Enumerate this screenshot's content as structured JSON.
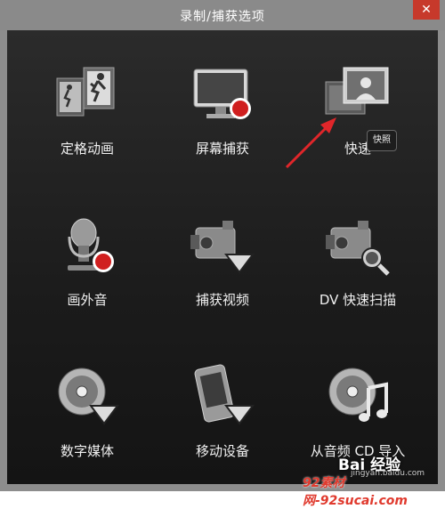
{
  "window": {
    "title": "录制/捕获选项",
    "close_symbol": "✕"
  },
  "tiles": [
    {
      "label": "定格动画"
    },
    {
      "label": "屏幕捕获"
    },
    {
      "label": "快速"
    },
    {
      "label": "画外音"
    },
    {
      "label": "捕获视频"
    },
    {
      "label": "DV 快速扫描"
    },
    {
      "label": "数字媒体"
    },
    {
      "label": "移动设备"
    },
    {
      "label": "从音频 CD 导入"
    }
  ],
  "tooltip": {
    "text": "快照"
  },
  "watermarks": {
    "baidu": "Bai 经验",
    "baidu_sub": "jingyan.baidu.com",
    "site": "92素材网-92sucai.com"
  },
  "colors": {
    "arrow": "#e0262a",
    "record_dot": "#d01f1f"
  }
}
